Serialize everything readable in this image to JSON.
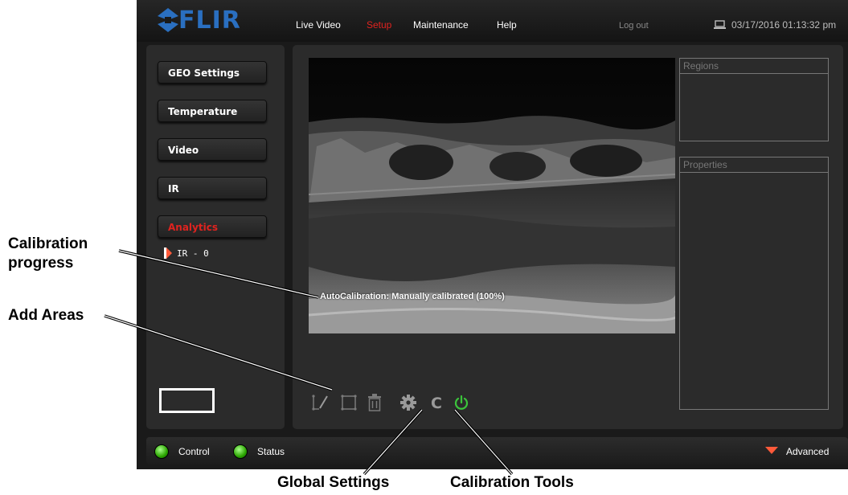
{
  "header": {
    "logo": "FLIR",
    "nav": [
      "Live Video",
      "Setup",
      "Maintenance",
      "Help"
    ],
    "active_nav": "Setup",
    "logout": "Log out",
    "datetime": "03/17/2016 01:13:32 pm"
  },
  "sidebar": {
    "items": [
      {
        "label": "GEO Settings"
      },
      {
        "label": "Temperature"
      },
      {
        "label": "Video"
      },
      {
        "label": "IR"
      },
      {
        "label": "Analytics"
      }
    ],
    "active_item": "Analytics",
    "sub_item": "IR - 0"
  },
  "video": {
    "overlay": "AutoCalibration: Manually calibrated (100%)"
  },
  "panels": {
    "regions_title": "Regions",
    "properties_title": "Properties"
  },
  "toolbar": {
    "icons": [
      "polygon-area-icon",
      "rectangle-area-icon",
      "trash-icon",
      "gear-icon",
      "calibration-c-icon",
      "power-icon"
    ]
  },
  "statusbar": {
    "control": "Control",
    "status": "Status",
    "advanced": "Advanced"
  },
  "callouts": {
    "calibration_progress": "Calibration\nprogress",
    "add_areas": "Add Areas",
    "global_settings": "Global Settings",
    "calibration_tools": "Calibration Tools"
  },
  "colors": {
    "brand_blue": "#2a6fc0",
    "active_red": "#e0231f",
    "led_green": "#2aa400",
    "power_green": "#3bc43b"
  }
}
